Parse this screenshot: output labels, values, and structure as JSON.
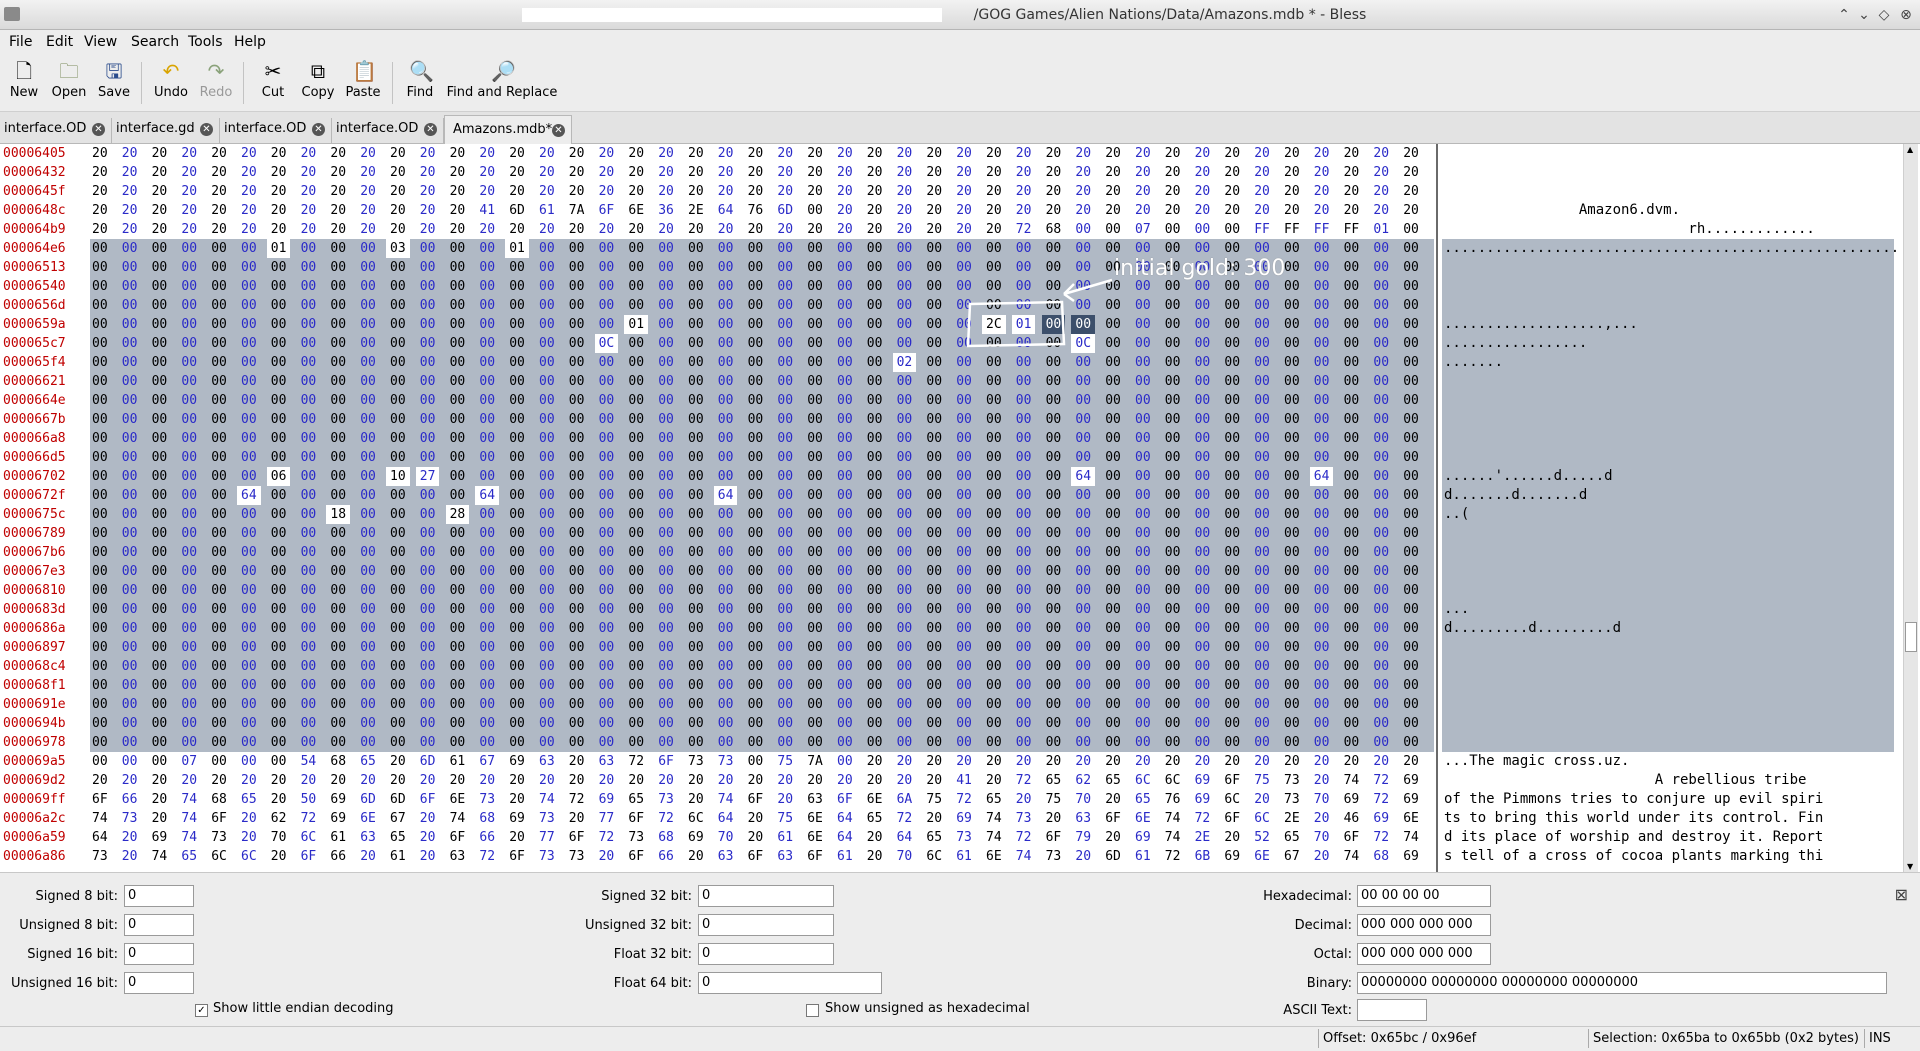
{
  "window": {
    "title": "/GOG Games/Alien Nations/Data/Amazons.mdb * - Bless"
  },
  "menu": [
    "File",
    "Edit",
    "View",
    "Search",
    "Tools",
    "Help"
  ],
  "toolbar": {
    "new": "New",
    "open": "Open",
    "save": "Save",
    "undo": "Undo",
    "redo": "Redo",
    "cut": "Cut",
    "copy": "Copy",
    "paste": "Paste",
    "find": "Find",
    "find_replace": "Find and Replace"
  },
  "tabs": [
    "interface.OD",
    "interface.gd",
    "interface.OD",
    "interface.OD",
    "Amazons.mdb*"
  ],
  "hex_view": {
    "offsets": [
      "00006405",
      "00006432",
      "0000645f",
      "0000648c",
      "000064b9",
      "000064e6",
      "00006513",
      "00006540",
      "0000656d",
      "0000659a",
      "000065c7",
      "000065f4",
      "00006621",
      "0000664e",
      "0000667b",
      "000066a8",
      "000066d5",
      "00006702",
      "0000672f",
      "0000675c",
      "00006789",
      "000067b6",
      "000067e3",
      "00006810",
      "0000683d",
      "0000686a",
      "00006897",
      "000068c4",
      "000068f1",
      "0000691e",
      "0000694b",
      "00006978",
      "000069a5",
      "000069d2",
      "000069ff",
      "00006a2c",
      "00006a59",
      "00006a86"
    ],
    "rows": [
      "20 20 20 20 20 20 20 20 20 20 20 20 20 20 20 20 20 20 20 20 20 20 20 20 20 20 20 20 20 20 20 20 20 20 20 20 20 20 20 20 20 20 20 20 20",
      "20 20 20 20 20 20 20 20 20 20 20 20 20 20 20 20 20 20 20 20 20 20 20 20 20 20 20 20 20 20 20 20 20 20 20 20 20 20 20 20 20 20 20 20 20",
      "20 20 20 20 20 20 20 20 20 20 20 20 20 20 20 20 20 20 20 20 20 20 20 20 20 20 20 20 20 20 20 20 20 20 20 20 20 20 20 20 20 20 20 20 20",
      "20 20 20 20 20 20 20 20 20 20 20 20 20 41 6D 61 7A 6F 6E 36 2E 64 76 6D 00 20 20 20 20 20 20 20 20 20 20 20 20 20 20 20 20 20 20 20 20",
      "20 20 20 20 20 20 20 20 20 20 20 20 20 20 20 20 20 20 20 20 20 20 20 20 20 20 20 20 20 20 20 72 68 00 00 07 00 00 00 FF FF FF FF 01 00",
      "00 00 00 00 00 00 01 00 00 00 03 00 00 00 01 00 00 00 00 00 00 00 00 00 00 00 00 00 00 00 00 00 00 00 00 00 00 00 00 00 00 00 00 00 00",
      "00 00 00 00 00 00 00 00 00 00 00 00 00 00 00 00 00 00 00 00 00 00 00 00 00 00 00 00 00 00 00 00 00 00 00 00 00 00 00 00 00 00 00 00 00",
      "00 00 00 00 00 00 00 00 00 00 00 00 00 00 00 00 00 00 00 00 00 00 00 00 00 00 00 00 00 00 00 00 00 00 00 00 00 00 00 00 00 00 00 00 00",
      "00 00 00 00 00 00 00 00 00 00 00 00 00 00 00 00 00 00 00 00 00 00 00 00 00 00 00 00 00 00 00 00 00 00 00 00 00 00 00 00 00 00 00 00 00",
      "00 00 00 00 00 00 00 00 00 00 00 00 00 00 00 00 00 00 01 00 00 00 00 00 00 00 00 00 00 00 2C 01 00 00 00 00 00 00 00 00 00 00 00 00 00",
      "00 00 00 00 00 00 00 00 00 00 00 00 00 00 00 00 00 0C 00 00 00 00 00 00 00 00 00 00 00 00 00 00 00 0C 00 00 00 00 00 00 00 00 00 00 00",
      "00 00 00 00 00 00 00 00 00 00 00 00 00 00 00 00 00 00 00 00 00 00 00 00 00 00 00 02 00 00 00 00 00 00 00 00 00 00 00 00 00 00 00 00 00",
      "00 00 00 00 00 00 00 00 00 00 00 00 00 00 00 00 00 00 00 00 00 00 00 00 00 00 00 00 00 00 00 00 00 00 00 00 00 00 00 00 00 00 00 00 00",
      "00 00 00 00 00 00 00 00 00 00 00 00 00 00 00 00 00 00 00 00 00 00 00 00 00 00 00 00 00 00 00 00 00 00 00 00 00 00 00 00 00 00 00 00 00",
      "00 00 00 00 00 00 00 00 00 00 00 00 00 00 00 00 00 00 00 00 00 00 00 00 00 00 00 00 00 00 00 00 00 00 00 00 00 00 00 00 00 00 00 00 00",
      "00 00 00 00 00 00 00 00 00 00 00 00 00 00 00 00 00 00 00 00 00 00 00 00 00 00 00 00 00 00 00 00 00 00 00 00 00 00 00 00 00 00 00 00 00",
      "00 00 00 00 00 00 00 00 00 00 00 00 00 00 00 00 00 00 00 00 00 00 00 00 00 00 00 00 00 00 00 00 00 00 00 00 00 00 00 00 00 00 00 00 00",
      "00 00 00 00 00 00 06 00 00 00 10 27 00 00 00 00 00 00 00 00 00 00 00 00 00 00 00 00 00 00 00 00 00 64 00 00 00 00 00 00 00 64 00 00 00",
      "00 00 00 00 00 64 00 00 00 00 00 00 00 64 00 00 00 00 00 00 00 64 00 00 00 00 00 00 00 00 00 00 00 00 00 00 00 00 00 00 00 00 00 00 00",
      "00 00 00 00 00 00 00 00 18 00 00 00 28 00 00 00 00 00 00 00 00 00 00 00 00 00 00 00 00 00 00 00 00 00 00 00 00 00 00 00 00 00 00 00 00",
      "00 00 00 00 00 00 00 00 00 00 00 00 00 00 00 00 00 00 00 00 00 00 00 00 00 00 00 00 00 00 00 00 00 00 00 00 00 00 00 00 00 00 00 00 00",
      "00 00 00 00 00 00 00 00 00 00 00 00 00 00 00 00 00 00 00 00 00 00 00 00 00 00 00 00 00 00 00 00 00 00 00 00 00 00 00 00 00 00 00 00 00",
      "00 00 00 00 00 00 00 00 00 00 00 00 00 00 00 00 00 00 00 00 00 00 00 00 00 00 00 00 00 00 00 00 00 00 00 00 00 00 00 00 00 00 00 00 00",
      "00 00 00 00 00 00 00 00 00 00 00 00 00 00 00 00 00 00 00 00 00 00 00 00 00 00 00 00 00 00 00 00 00 00 00 00 00 00 00 00 00 00 00 00 00",
      "00 00 00 00 00 00 00 00 00 00 00 00 00 00 00 00 00 00 00 00 00 00 00 00 00 00 00 00 00 00 00 00 00 00 00 00 00 00 00 00 00 00 00 00 00",
      "00 00 00 00 00 00 00 00 00 00 00 00 00 00 00 00 00 00 00 00 00 00 00 00 00 00 00 00 00 00 00 00 00 00 00 00 00 00 00 00 00 00 00 00 00",
      "00 00 00 00 00 00 00 00 00 00 00 00 00 00 00 00 00 00 00 00 00 00 00 00 00 00 00 00 00 00 00 00 00 00 00 00 00 00 00 00 00 00 00 00 00",
      "00 00 00 00 00 00 00 00 00 00 00 00 00 00 00 00 00 00 00 00 00 00 00 00 00 00 00 00 00 00 00 00 00 00 00 00 00 00 00 00 00 00 00 00 00",
      "00 00 00 00 00 00 00 00 00 00 00 00 00 00 00 00 00 00 00 00 00 00 00 00 00 00 00 00 00 00 00 00 00 00 00 00 00 00 00 00 00 00 00 00 00",
      "00 00 00 00 00 00 00 00 00 00 00 00 00 00 00 00 00 00 00 00 00 00 00 00 00 00 00 00 00 00 00 00 00 00 00 00 00 00 00 00 00 00 00 00 00",
      "00 00 00 00 00 00 00 00 00 00 00 00 00 00 00 00 00 00 00 00 00 00 00 00 00 00 00 00 00 00 00 00 00 00 00 00 00 00 00 00 00 00 00 00 00",
      "00 00 00 00 00 00 00 00 00 00 00 00 00 00 00 00 00 00 00 00 00 00 00 00 00 00 00 00 00 00 00 00 00 00 00 00 00 00 00 00 00 00 00 00 00",
      "00 00 00 07 00 00 00 54 68 65 20 6D 61 67 69 63 20 63 72 6F 73 73 00 75 7A 00 20 20 20 20 20 20 20 20 20 20 20 20 20 20 20 20 20 20 20",
      "20 20 20 20 20 20 20 20 20 20 20 20 20 20 20 20 20 20 20 20 20 20 20 20 20 20 20 20 20 41 20 72 65 62 65 6C 6C 69 6F 75 73 20 74 72 69 62 65 20",
      "6F 66 20 74 68 65 20 50 69 6D 6D 6F 6E 73 20 74 72 69 65 73 20 74 6F 20 63 6F 6E 6A 75 72 65 20 75 70 20 65 76 69 6C 20 73 70 69 72 69",
      "74 73 20 74 6F 20 62 72 69 6E 67 20 74 68 69 73 20 77 6F 72 6C 64 20 75 6E 64 65 72 20 69 74 73 20 63 6F 6E 74 72 6F 6C 2E 20 46 69 6E",
      "64 20 69 74 73 20 70 6C 61 63 65 20 6F 66 20 77 6F 72 73 68 69 70 20 61 6E 64 20 64 65 73 74 72 6F 79 20 69 74 2E 20 52 65 70 6F 72 74",
      "73 20 74 65 6C 6C 20 6F 66 20 61 20 63 72 6F 73 73 20 6F 66 20 63 6F 63 6F 61 20 70 6C 61 6E 74 73 20 6D 61 72 6B 69 6E 67 20 74 68 69"
    ],
    "ascii": [
      "",
      "",
      "",
      "                Amazon6.dvm.",
      "                             rh.............",
      "......................................................",
      "",
      "",
      "",
      "...................,...",
      ".................",
      ".......",
      "",
      "",
      "",
      "",
      "",
      "......'......d.....d",
      "d.......d.......d",
      "..(",
      "",
      "",
      "",
      "",
      "...",
      "d.........d.........d",
      "",
      "",
      "",
      "",
      "",
      "",
      "...The magic cross.uz.",
      "                         A rebellious tribe",
      "of the Pimmons tries to conjure up evil spiri",
      "ts to bring this world under its control. Fin",
      "d its place of worship and destroy it. Report",
      "s tell of a cross of cocoa plants marking thi"
    ],
    "annotation": "initial gold: 300"
  },
  "panel": {
    "signed8_label": "Signed 8 bit:",
    "signed8": "0",
    "unsigned8_label": "Unsigned 8 bit:",
    "unsigned8": "0",
    "signed16_label": "Signed 16 bit:",
    "signed16": "0",
    "unsigned16_label": "Unsigned 16 bit:",
    "unsigned16": "0",
    "signed32_label": "Signed 32 bit:",
    "signed32": "0",
    "unsigned32_label": "Unsigned 32 bit:",
    "unsigned32": "0",
    "float32_label": "Float 32 bit:",
    "float32": "0",
    "float64_label": "Float 64 bit:",
    "float64": "0",
    "hex_label": "Hexadecimal:",
    "hex": "00 00 00 00",
    "dec_label": "Decimal:",
    "dec": "000 000 000 000",
    "oct_label": "Octal:",
    "oct": "000 000 000 000",
    "bin_label": "Binary:",
    "bin": "00000000 00000000 00000000 00000000",
    "ascii_label": "ASCII Text:",
    "ascii": "",
    "little_endian": "Show little endian decoding",
    "unsigned_hex": "Show unsigned as hexadecimal"
  },
  "status": {
    "offset": "Offset: 0x65bc / 0x96ef",
    "selection": "Selection: 0x65ba to 0x65bb (0x2 bytes)",
    "mode": "INS"
  }
}
